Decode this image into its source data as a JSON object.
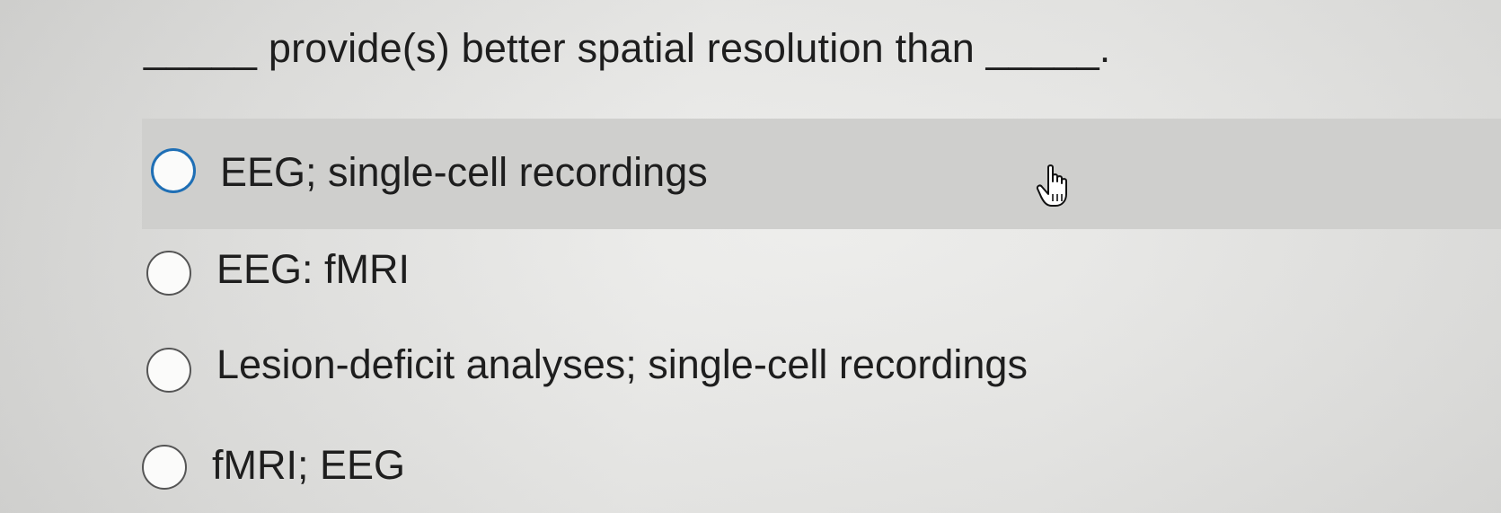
{
  "question": {
    "text": "_____ provide(s) better spatial resolution than _____."
  },
  "options": [
    {
      "label": "EEG; single-cell recordings",
      "selected": false,
      "hovered": true
    },
    {
      "label": "EEG: fMRI",
      "selected": false,
      "hovered": false
    },
    {
      "label": "Lesion-deficit analyses; single-cell recordings",
      "selected": false,
      "hovered": false
    },
    {
      "label": "fMRI; EEG",
      "selected": false,
      "hovered": false
    }
  ],
  "cursor": {
    "icon": "hand-pointer-icon"
  },
  "colors": {
    "focus_ring": "#1f6fb5",
    "hover_bg": "#cfcfcd"
  }
}
